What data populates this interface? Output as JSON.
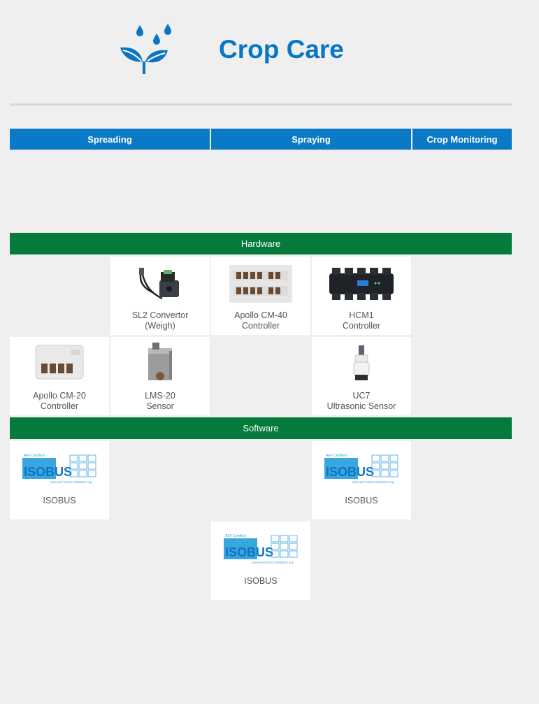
{
  "page": {
    "title": "Crop Care"
  },
  "tabs": [
    "Spreading",
    "Spraying",
    "Crop Monitoring"
  ],
  "sections": {
    "hardware": "Hardware",
    "software": "Software"
  },
  "hardware": [
    {
      "line1": "SL2 Convertor",
      "line2": "(Weigh)"
    },
    {
      "line1": "Apollo CM-40",
      "line2": "Controller"
    },
    {
      "line1": "HCM1",
      "line2": "Controller"
    },
    {
      "line1": "Apollo CM-20",
      "line2": "Controller"
    },
    {
      "line1": "LMS-20",
      "line2": "Sensor"
    },
    {
      "line1": "UC7",
      "line2": "Ultrasonic Sensor"
    }
  ],
  "software": [
    "ISOBUS",
    "ISOBUS",
    "ISOBUS"
  ],
  "isobus_logo": {
    "certified": "AEF Certified",
    "wordmark": "ISOBUS",
    "url": "www.aef-isobus-database.org"
  },
  "colors": {
    "brand_blue": "#0a75c2",
    "tab_blue": "#0a7ac7",
    "section_green": "#047b3b"
  },
  "icons": {
    "logo": "droplets-and-sprout-icon"
  }
}
